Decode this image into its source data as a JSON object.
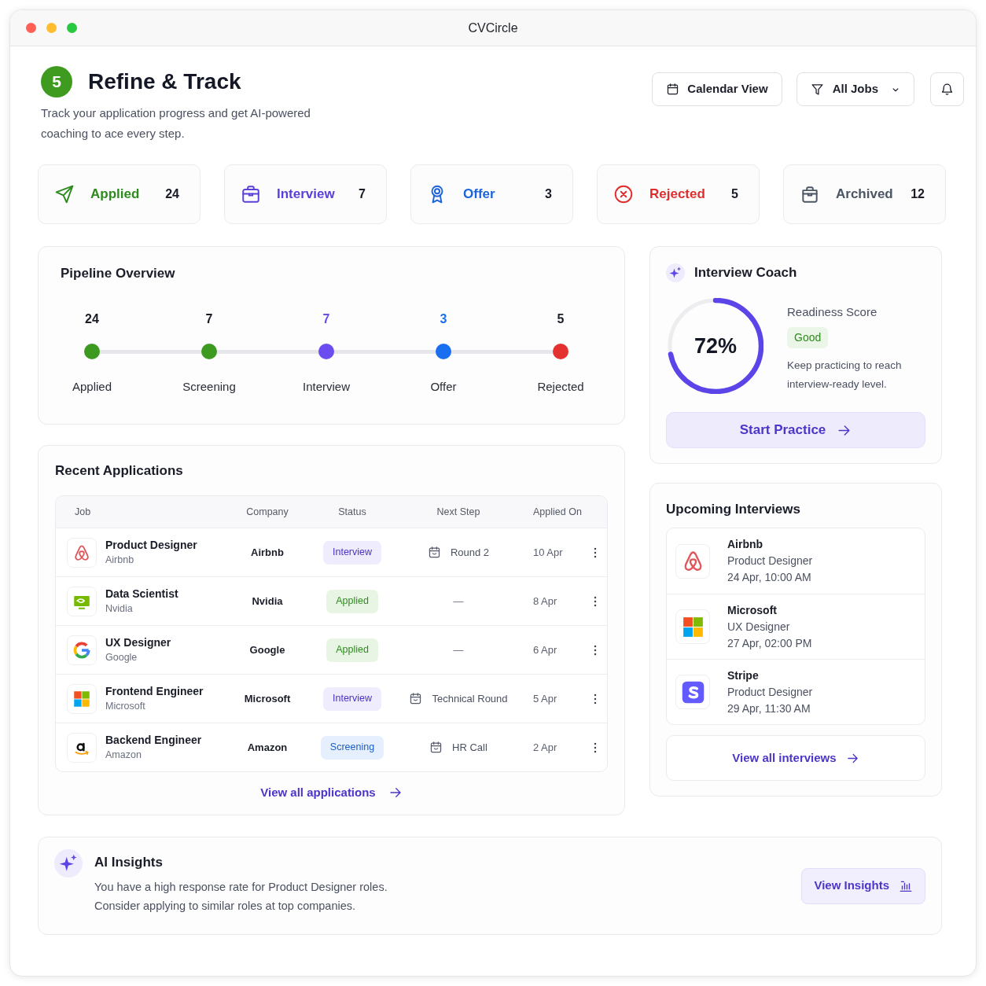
{
  "window": {
    "title": "CVCircle"
  },
  "header": {
    "step": "5",
    "title": "Refine & Track",
    "subtitle": "Track your application progress and get AI-powered coaching to ace every step.",
    "actions": [
      {
        "kind": "calendar",
        "label": "Calendar View"
      },
      {
        "kind": "filter",
        "label": "All Jobs"
      },
      {
        "kind": "notifications"
      }
    ]
  },
  "status_cards": [
    {
      "kind": "applied",
      "label": "Applied",
      "count": "24",
      "color": "#2e8b1e"
    },
    {
      "kind": "interview",
      "label": "Interview",
      "count": "7",
      "color": "#5b3fd9"
    },
    {
      "kind": "offer",
      "label": "Offer",
      "count": "3",
      "color": "#1c64d9"
    },
    {
      "kind": "rejected",
      "label": "Rejected",
      "count": "5",
      "color": "#e02d2d"
    },
    {
      "kind": "archived",
      "label": "Archived",
      "count": "12",
      "color": "#4b5563"
    }
  ],
  "pipeline": {
    "title": "Pipeline Overview",
    "stages": [
      {
        "label": "Applied",
        "count": "24",
        "color": "#3b9a1f",
        "highlighted": false
      },
      {
        "label": "Screening",
        "count": "7",
        "color": "#3b9a1f",
        "highlighted": false
      },
      {
        "label": "Interview",
        "count": "7",
        "color": "#6c4cf1",
        "highlighted": true
      },
      {
        "label": "Offer",
        "count": "3",
        "color": "#1a6ff0",
        "highlighted": true
      },
      {
        "label": "Rejected",
        "count": "5",
        "color": "#e53030",
        "highlighted": false
      }
    ]
  },
  "interview_coach": {
    "title": "Interview Coach",
    "score": "72%",
    "level": 0.72,
    "score_label": "Readiness Score",
    "rating": "Good",
    "note": "Keep practicing to reach interview-ready level.",
    "button": "Start Practice"
  },
  "recent_applications": {
    "title": "Recent Applications",
    "columns": [
      "Job",
      "Company",
      "Status",
      "Next Step",
      "Applied On"
    ],
    "rows": [
      {
        "logo": {
          "kind": "airbnb"
        },
        "job": "Product Designer",
        "job_company": "Airbnb",
        "company": "Airbnb",
        "status": {
          "kind": "interview",
          "label": "Interview"
        },
        "next_step": {
          "kind": "event",
          "label": "Round 2"
        },
        "applied_on": "10 Apr"
      },
      {
        "logo": {
          "kind": "nvidia"
        },
        "job": "Data Scientist",
        "job_company": "Nvidia",
        "company": "Nvidia",
        "status": {
          "kind": "applied",
          "label": "Applied"
        },
        "next_step": {
          "kind": "none",
          "label": "—"
        },
        "applied_on": "8 Apr"
      },
      {
        "logo": {
          "kind": "google"
        },
        "job": "UX Designer",
        "job_company": "Google",
        "company": "Google",
        "status": {
          "kind": "applied",
          "label": "Applied"
        },
        "next_step": {
          "kind": "none",
          "label": "—"
        },
        "applied_on": "6 Apr"
      },
      {
        "logo": {
          "kind": "microsoft"
        },
        "job": "Frontend Engineer",
        "job_company": "Microsoft",
        "company": "Microsoft",
        "status": {
          "kind": "interview",
          "label": "Interview"
        },
        "next_step": {
          "kind": "event",
          "label": "Technical Round"
        },
        "applied_on": "5 Apr"
      },
      {
        "logo": {
          "kind": "amazon"
        },
        "job": "Backend Engineer",
        "job_company": "Amazon",
        "company": "Amazon",
        "status": {
          "kind": "screening",
          "label": "Screening"
        },
        "next_step": {
          "kind": "event",
          "label": "HR Call"
        },
        "applied_on": "2 Apr"
      }
    ],
    "link": "View all applications"
  },
  "upcoming_interviews": {
    "title": "Upcoming Interviews",
    "items": [
      {
        "logo": {
          "kind": "airbnb"
        },
        "company": "Airbnb",
        "role": "Product Designer",
        "time": "24 Apr, 10:00 AM"
      },
      {
        "logo": {
          "kind": "microsoft"
        },
        "company": "Microsoft",
        "role": "UX Designer",
        "time": "27 Apr, 02:00 PM"
      },
      {
        "logo": {
          "kind": "stripe"
        },
        "company": "Stripe",
        "role": "Product Designer",
        "time": "29 Apr, 11:30 AM"
      }
    ],
    "link": "View all interviews"
  },
  "ai_insights": {
    "title": "AI Insights",
    "lines": [
      "You have a high response rate for Product Designer roles.",
      "Consider applying to similar roles at top companies."
    ],
    "button": "View Insights"
  }
}
